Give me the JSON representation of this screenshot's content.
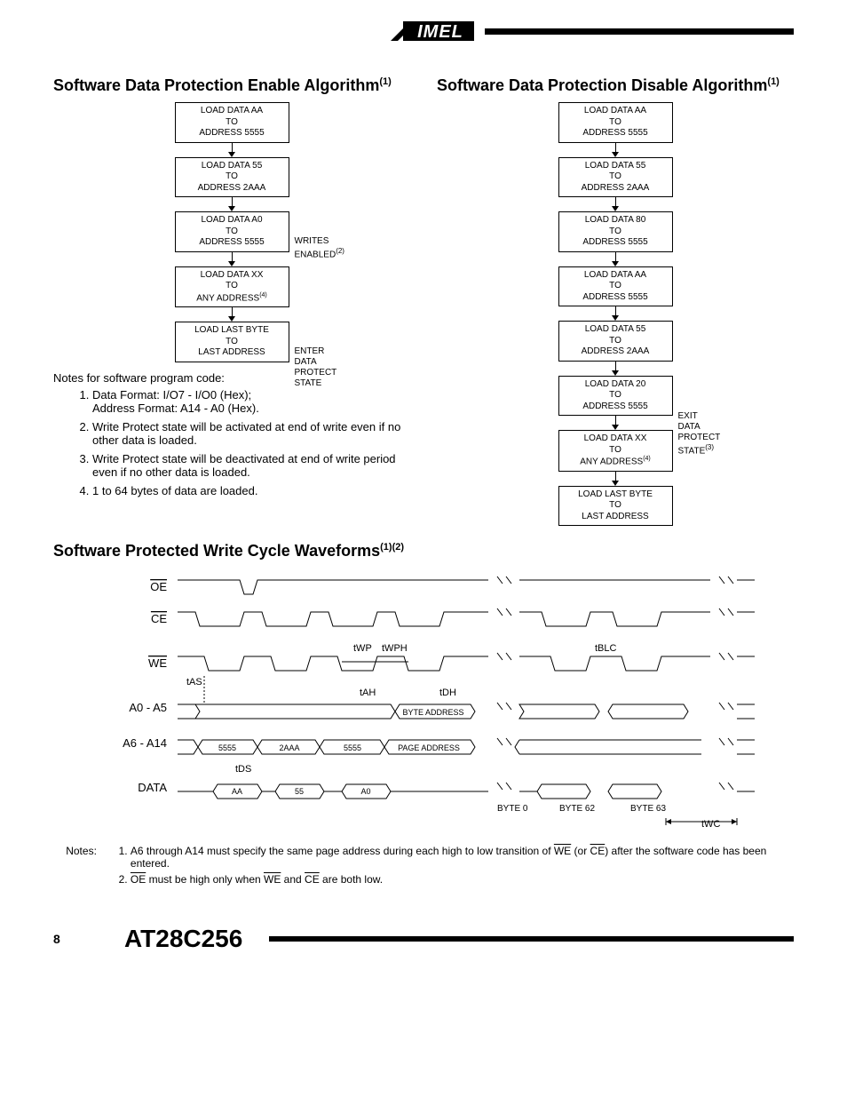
{
  "logo_text": "AIMEL",
  "section_enable": {
    "title": "Software Data Protection Enable Algorithm",
    "sup": "(1)",
    "steps": [
      "LOAD DATA AA\nTO\nADDRESS 5555",
      "LOAD DATA 55\nTO\nADDRESS 2AAA",
      "LOAD DATA A0\nTO\nADDRESS 5555",
      "LOAD DATA XX\nTO\nANY ADDRESS",
      "LOAD LAST BYTE\nTO\nLAST ADDRESS"
    ],
    "label_writes": "WRITES ENABLED",
    "label_writes_sup": "(2)",
    "label_any_sup": "(4)",
    "label_enter": "ENTER DATA\nPROTECT STATE"
  },
  "section_disable": {
    "title": "Software Data Protection Disable Algorithm",
    "sup": "(1)",
    "steps": [
      "LOAD DATA AA\nTO\nADDRESS 5555",
      "LOAD DATA 55\nTO\nADDRESS 2AAA",
      "LOAD DATA 80\nTO\nADDRESS 5555",
      "LOAD DATA AA\nTO\nADDRESS 5555",
      "LOAD DATA 55\nTO\nADDRESS 2AAA",
      "LOAD DATA 20\nTO\nADDRESS 5555",
      "LOAD DATA XX\nTO\nANY ADDRESS",
      "LOAD LAST BYTE\nTO\nLAST ADDRESS"
    ],
    "label_exit": "EXIT DATA\nPROTECT STATE",
    "label_exit_sup": "(3)",
    "label_any_sup": "(4)"
  },
  "notes_header": "Notes for software program code:",
  "notes": [
    "Data Format: I/O7 - I/O0 (Hex);\nAddress Format: A14 - A0 (Hex).",
    "Write Protect state will be activated at end of write even if no other data is loaded.",
    "Write Protect state will be deactivated at end of write period even if no other data is loaded.",
    "1 to 64 bytes of data are loaded."
  ],
  "waveform": {
    "title": "Software Protected Write Cycle Waveforms",
    "sup": "(1)(2)",
    "signals": [
      "OE",
      "CE",
      "WE",
      "A0 - A5",
      "A6 - A14",
      "DATA"
    ],
    "timing_labels": [
      "tWP",
      "tWPH",
      "tBLC",
      "tAS",
      "tAH",
      "tDH",
      "tDS",
      "tWC"
    ],
    "addr_labels_a0a5": [
      "BYTE ADDRESS"
    ],
    "addr_labels_a6a14": [
      "5555",
      "2AAA",
      "5555",
      "PAGE ADDRESS"
    ],
    "data_labels": [
      "AA",
      "55",
      "A0"
    ],
    "byte_labels": [
      "BYTE 0",
      "BYTE 62",
      "BYTE 63"
    ]
  },
  "waveform_notes_label": "Notes:",
  "waveform_notes": [
    "A6 through A14 must specify the same page address during each high to low transition of WE (or CE) after the software code has been entered.",
    "OE must be high only when WE and CE are both low."
  ],
  "page_number": "8",
  "part_number": "AT28C256"
}
